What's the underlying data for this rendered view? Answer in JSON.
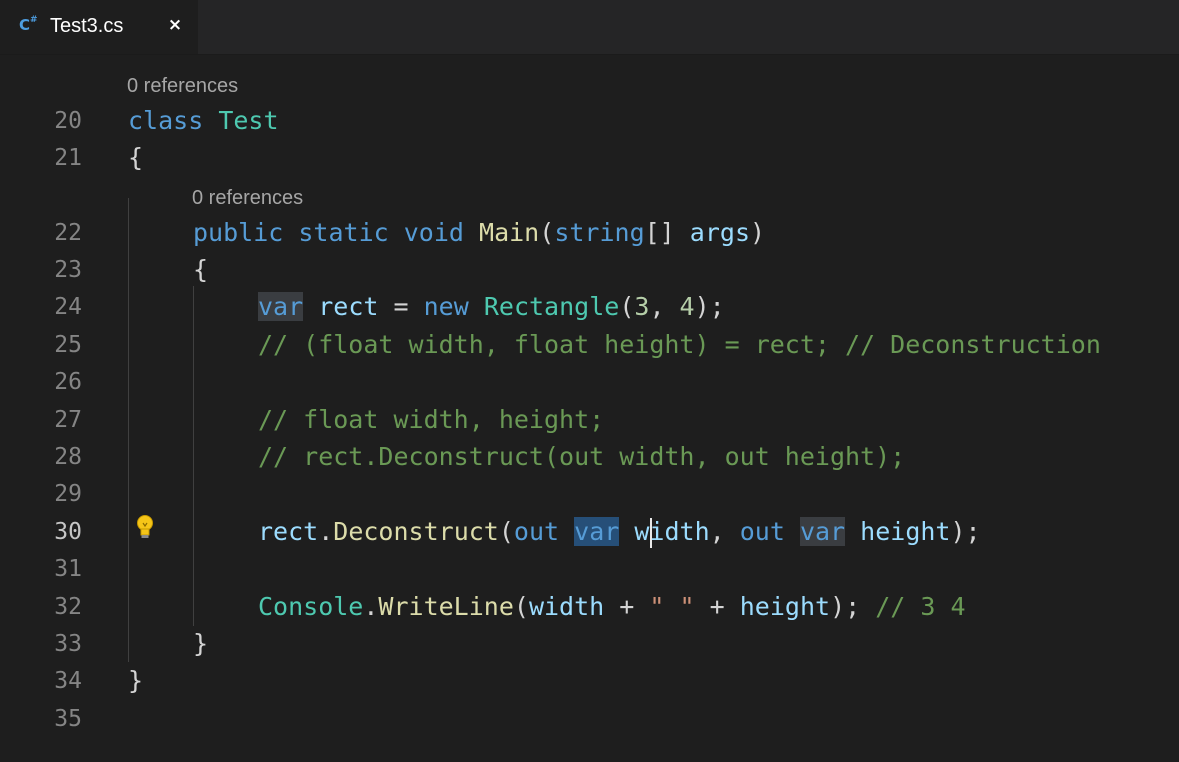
{
  "tab": {
    "icon_label": "C#",
    "title": "Test3.cs",
    "close_symbol": "×"
  },
  "code_lens": {
    "class_refs": "0 references",
    "method_refs": "0 references"
  },
  "line_numbers": [
    "20",
    "21",
    "22",
    "23",
    "24",
    "25",
    "26",
    "27",
    "28",
    "29",
    "30",
    "31",
    "32",
    "33",
    "34",
    "35"
  ],
  "active_line": "30",
  "code": {
    "l20_kw": "class",
    "l20_type": "Test",
    "l21": "{",
    "l22_kw1": "public",
    "l22_kw2": "static",
    "l22_kw3": "void",
    "l22_fn": "Main",
    "l22_p1": "(",
    "l22_kw4": "string",
    "l22_p2": "[]",
    "l22_id": "args",
    "l22_p3": ")",
    "l23": "{",
    "l24_kw": "var",
    "l24_id": "rect",
    "l24_op": "=",
    "l24_kw2": "new",
    "l24_ty": "Rectangle",
    "l24_p1": "(",
    "l24_n1": "3",
    "l24_c": ", ",
    "l24_n2": "4",
    "l24_p2": ");",
    "l25_cm": "// (float width, float height) = rect; // Deconstruction",
    "l27_cm": "// float width, height;",
    "l28_cm": "// rect.Deconstruct(out width, out height);",
    "l30_id": "rect",
    "l30_dot": ".",
    "l30_fn": "Deconstruct",
    "l30_p1": "(",
    "l30_kw1": "out",
    "l30_kw2": "var",
    "l30_id2": "width",
    "l30_c": ", ",
    "l30_kw3": "out",
    "l30_kw4": "var",
    "l30_id3": "height",
    "l30_p2": ");",
    "l32_ty": "Console",
    "l32_dot": ".",
    "l32_fn": "WriteLine",
    "l32_p1": "(",
    "l32_id1": "width",
    "l32_op1": "+",
    "l32_str": "\" \"",
    "l32_op2": "+",
    "l32_id2": "height",
    "l32_p2": ");",
    "l32_cm": "// 3 4",
    "l33": "}",
    "l34": "}"
  },
  "colors": {
    "background": "#1e1e1e",
    "keyword": "#569cd6",
    "type": "#4ec9b0",
    "function": "#dcdcaa",
    "identifier": "#9cdcfe",
    "number": "#b5cea8",
    "string": "#ce9178",
    "comment": "#6a9955"
  }
}
